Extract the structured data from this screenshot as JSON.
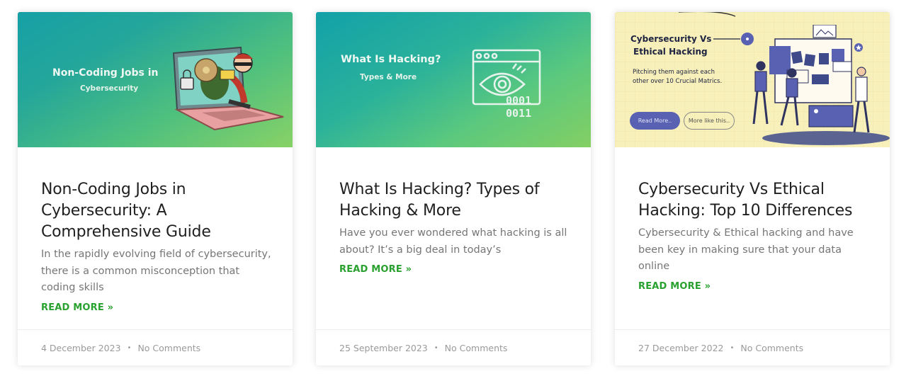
{
  "posts": [
    {
      "image": {
        "title": "Non-Coding Jobs in",
        "subtitle": "Cybersecurity",
        "illustration": "laptop-thief-icon"
      },
      "title": "Non-Coding Jobs in Cybersecurity: A Comprehensive Guide",
      "excerpt": "In the rapidly evolving field of cybersecurity, there is a common misconception that coding skills",
      "read_more": "READ MORE »",
      "date": "4 December 2023",
      "separator": "•",
      "comments": "No Comments"
    },
    {
      "image": {
        "title": "What Is Hacking?",
        "subtitle": "Types & More",
        "illustration": "eye-window-binary-icon"
      },
      "title": "What Is Hacking? Types of Hacking & More",
      "excerpt": "Have you ever wondered what hacking is all about? It’s a big deal in today’s",
      "read_more": "READ MORE »",
      "date": "25 September 2023",
      "separator": "•",
      "comments": "No Comments"
    },
    {
      "image": {
        "title_line1": "Cybersecurity Vs",
        "title_line2": "Ethical Hacking",
        "desc_line1": "Pitching them against each",
        "desc_line2": "other over 10 Crucial Matrics.",
        "btn_primary": "Read More..",
        "btn_secondary": "More like this..",
        "illustration": "team-board-icon"
      },
      "title": "Cybersecurity Vs Ethical Hacking: Top 10 Differences",
      "excerpt": "Cybersecurity & Ethical hacking and have been key in making sure that your data online",
      "read_more": "READ MORE »",
      "date": "27 December 2022",
      "separator": "•",
      "comments": "No Comments"
    }
  ],
  "colors": {
    "accent_green": "#28a12f",
    "meta_gray": "#9a9a9a",
    "excerpt_gray": "#767676"
  }
}
